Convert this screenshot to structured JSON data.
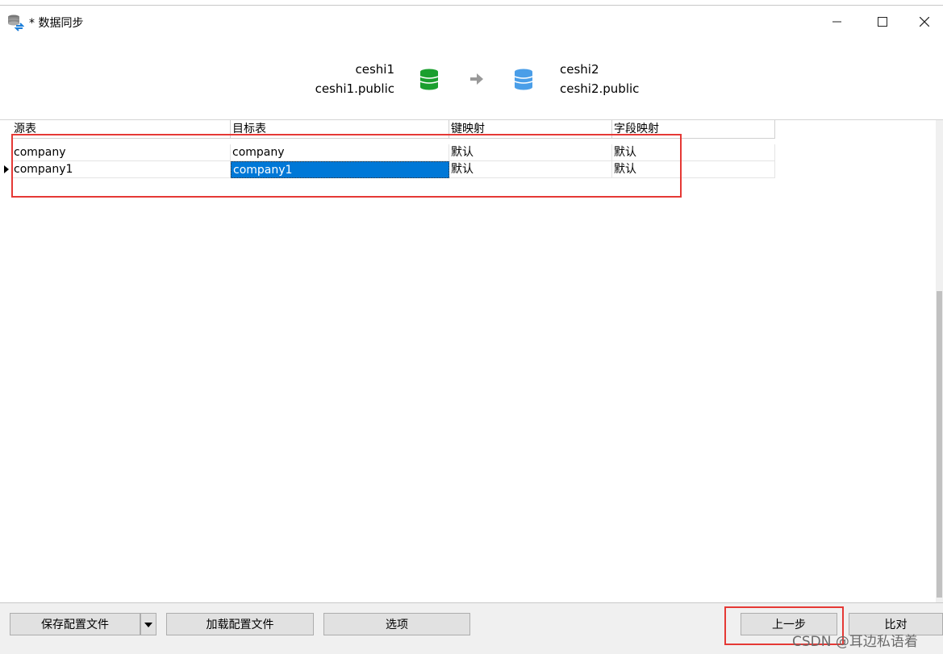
{
  "window": {
    "title": "* 数据同步",
    "icons": {
      "app": "database-sync-icon",
      "minimize": "minimize-icon",
      "maximize": "maximize-icon",
      "close": "close-icon"
    }
  },
  "connection": {
    "source": {
      "name": "ceshi1",
      "schema": "ceshi1.public",
      "icon": "database-icon",
      "color": "#1a9f2e"
    },
    "target": {
      "name": "ceshi2",
      "schema": "ceshi2.public",
      "icon": "database-icon",
      "color": "#4a9ee8"
    },
    "arrow_icon": "arrow-right-icon"
  },
  "grid": {
    "columns": [
      "源表",
      "目标表",
      "键映射",
      "字段映射"
    ],
    "rows": [
      {
        "source": "company",
        "target": "company",
        "key_map": "默认",
        "field_map": "默认"
      },
      {
        "source": "company1",
        "target": "company1",
        "key_map": "默认",
        "field_map": "默认",
        "selected": true
      }
    ]
  },
  "footer": {
    "save_config": "保存配置文件",
    "load_config": "加载配置文件",
    "options": "选项",
    "prev_step": "上一步",
    "compare": "比对"
  },
  "watermark": "CSDN @耳边私语着",
  "highlight_color": "#e53935",
  "selection_color": "#0078d7"
}
